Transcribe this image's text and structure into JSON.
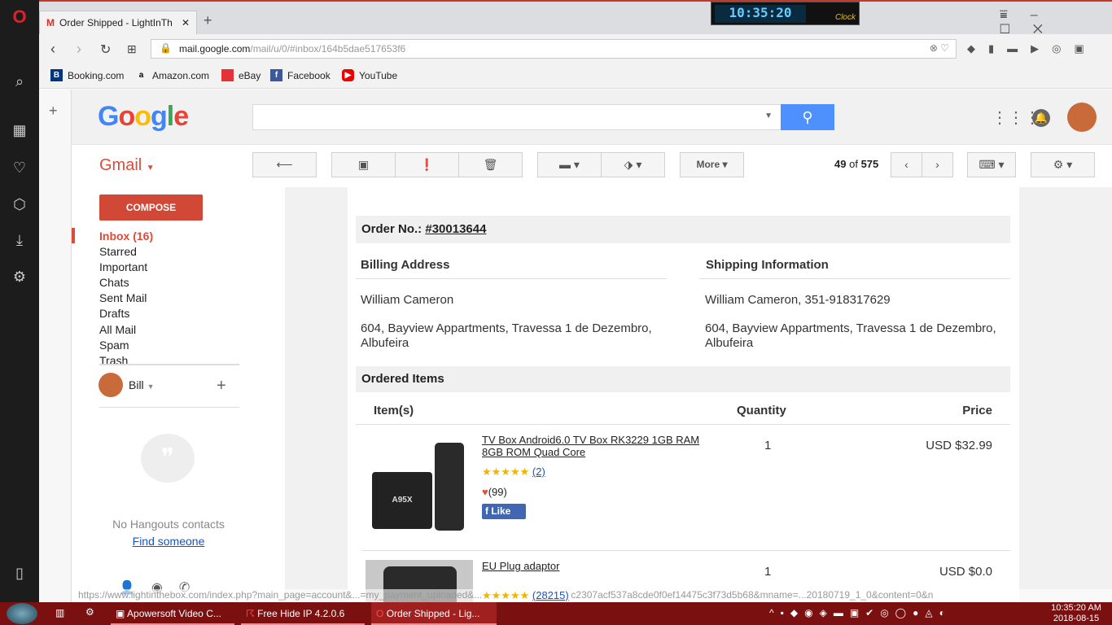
{
  "browser": {
    "tab_title": "Order Shipped - LightInTh",
    "url_host": "mail.google.com",
    "url_path": "/mail/u/0/#inbox/164b5dae517653f6",
    "bookmarks": [
      "Booking.com",
      "Amazon.com",
      "eBay",
      "Facebook",
      "YouTube"
    ],
    "clock": "10:35:20",
    "clock_label": "Clock"
  },
  "gmail": {
    "logo": "Google",
    "app_label": "Gmail",
    "compose": "COMPOSE",
    "more": "More",
    "count_current": "49",
    "count_of": "of",
    "count_total": "575",
    "nav": [
      "Inbox (16)",
      "Starred",
      "Important",
      "Chats",
      "Sent Mail",
      "Drafts",
      "All Mail",
      "Spam",
      "Trash"
    ],
    "user": "Bill",
    "hangouts_empty": "No Hangouts contacts",
    "find_someone": "Find someone"
  },
  "email": {
    "order_label": "Order No.:",
    "order_no": "#30013644",
    "billing_title": "Billing Address",
    "shipping_title": "Shipping Information",
    "billing_name": "William Cameron",
    "shipping_name": "William Cameron, 351-918317629",
    "address1": "604, Bayview Appartments, Travessa 1 de Dezembro,",
    "address2": "Albufeira",
    "ordered_title": "Ordered Items",
    "col_item": "Item(s)",
    "col_qty": "Quantity",
    "col_price": "Price",
    "items": [
      {
        "name_l1": "TV Box Android6.0 TV Box RK3229 1GB RAM",
        "name_l2": "8GB ROM Quad Core",
        "reviews": "(2)",
        "likes": "(99)",
        "like_btn": "Like",
        "qty": "1",
        "price": "USD $32.99",
        "rating": 5
      },
      {
        "name_l1": "EU Plug adaptor",
        "reviews": "(28215)",
        "qty": "1",
        "price": "USD $0.0"
      }
    ]
  },
  "status_url": "https://www.lightinthebox.com/index.php?main_page=account&...=my_payment_uploaded&...mail=d6584e6da63ec2307acf537a8cde0f0ef14475c3f73d5b68&mname=...20180719_1_0&content=0&n",
  "taskbar": {
    "tasks": [
      "Apowersoft Video C...",
      "Free Hide IP  4.2.0.6",
      "Order Shipped - Lig..."
    ],
    "time": "10:35:20 AM",
    "date": "2018-08-15"
  }
}
